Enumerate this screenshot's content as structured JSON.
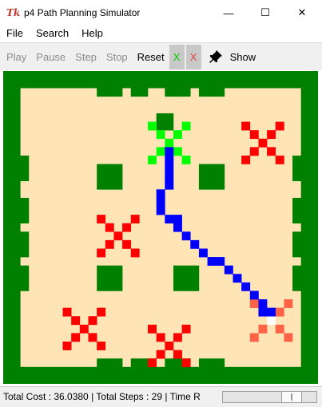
{
  "window": {
    "title": "p4 Path Planning Simulator",
    "icon_glyph": "Tk",
    "minimize_glyph": "—",
    "maximize_glyph": "☐",
    "close_glyph": "✕"
  },
  "menu": {
    "items": [
      "File",
      "Search",
      "Help"
    ]
  },
  "toolbar": {
    "play": "Play",
    "pause": "Pause",
    "step": "Step",
    "stop": "Stop",
    "reset": "Reset",
    "x_green": "X",
    "x_red": "X",
    "show": "Show",
    "pin_icon": "pushpin-icon"
  },
  "status": {
    "text": "Total Cost : 36.0380 | Total Steps : 29 | Time R",
    "speed_level": 0.8
  },
  "map": {
    "grid_cols": 37,
    "grid_rows": 37,
    "colors": {
      "free": "#ffe4b5",
      "wall": "#008000",
      "path": "#0000ff",
      "start": "#00ff00",
      "goal": "#ff6347",
      "danger": "#ff0000"
    },
    "walls": [
      [
        0,
        0,
        37,
        2
      ],
      [
        0,
        35,
        37,
        2
      ],
      [
        0,
        0,
        2,
        37
      ],
      [
        35,
        0,
        2,
        37
      ],
      [
        11,
        2,
        3,
        1
      ],
      [
        15,
        2,
        2,
        1
      ],
      [
        19,
        2,
        3,
        1
      ],
      [
        23,
        2,
        3,
        1
      ],
      [
        11,
        34,
        3,
        1
      ],
      [
        15,
        34,
        3,
        1
      ],
      [
        19,
        34,
        3,
        1
      ],
      [
        23,
        34,
        3,
        1
      ],
      [
        2,
        10,
        1,
        3
      ],
      [
        2,
        15,
        1,
        3
      ],
      [
        2,
        19,
        1,
        3
      ],
      [
        2,
        23,
        1,
        3
      ],
      [
        34,
        10,
        1,
        3
      ],
      [
        34,
        15,
        1,
        3
      ],
      [
        34,
        19,
        1,
        3
      ],
      [
        34,
        23,
        1,
        3
      ],
      [
        11,
        11,
        3,
        3
      ],
      [
        23,
        11,
        3,
        3
      ],
      [
        11,
        23,
        3,
        3
      ],
      [
        20,
        23,
        3,
        3
      ],
      [
        18,
        5,
        2,
        2
      ]
    ],
    "path": [
      [
        19,
        9
      ],
      [
        19,
        10
      ],
      [
        19,
        11
      ],
      [
        19,
        12
      ],
      [
        19,
        13
      ],
      [
        18,
        14
      ],
      [
        18,
        15
      ],
      [
        18,
        16
      ],
      [
        19,
        17
      ],
      [
        20,
        17
      ],
      [
        20,
        18
      ],
      [
        21,
        19
      ],
      [
        22,
        20
      ],
      [
        23,
        21
      ],
      [
        24,
        22
      ],
      [
        25,
        22
      ],
      [
        26,
        23
      ],
      [
        27,
        24
      ],
      [
        28,
        25
      ],
      [
        29,
        26
      ],
      [
        30,
        27
      ],
      [
        30,
        28
      ],
      [
        31,
        28
      ]
    ],
    "start": [
      19,
      8
    ],
    "goal": [
      31,
      29
    ],
    "danger_centers": [
      [
        30,
        8
      ],
      [
        13,
        19
      ],
      [
        9,
        30
      ],
      [
        19,
        32
      ]
    ]
  }
}
